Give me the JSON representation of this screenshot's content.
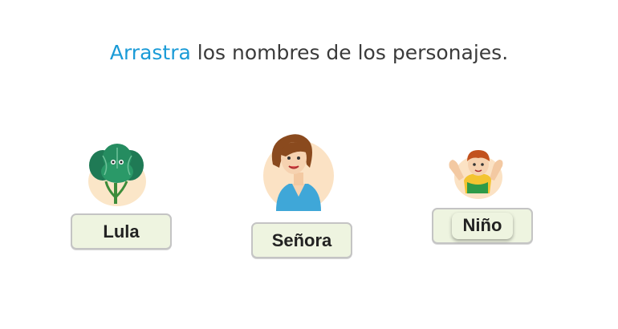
{
  "instruction": {
    "highlight": "Arrastra",
    "rest": " los nombres de los personajes.",
    "accent_color": "#1a9bd7"
  },
  "characters": [
    {
      "icon": "lettuce-character-icon",
      "slot_label": "Lula"
    },
    {
      "icon": "woman-character-icon",
      "slot_label": "Señora"
    },
    {
      "icon": "boy-character-icon",
      "slot_label": "Niño"
    }
  ]
}
